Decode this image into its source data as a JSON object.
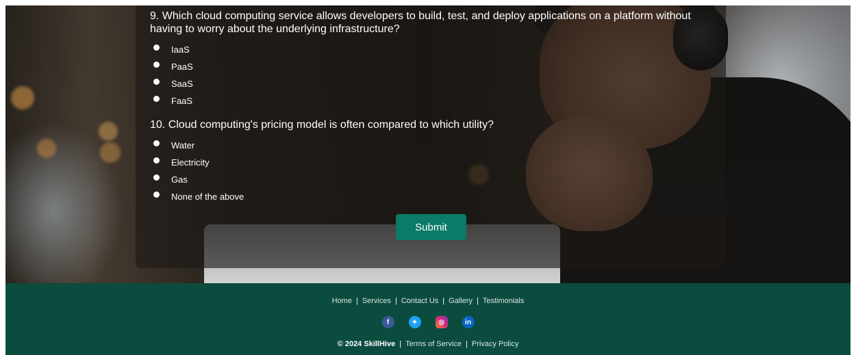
{
  "quiz": {
    "questions": [
      {
        "text": "9. Which cloud computing service allows developers to build, test, and deploy applications on a platform without having to worry about the underlying infrastructure?",
        "options": [
          "IaaS",
          "PaaS",
          "SaaS",
          "FaaS"
        ]
      },
      {
        "text": "10. Cloud computing's pricing model is often compared to which utility?",
        "options": [
          "Water",
          "Electricity",
          "Gas",
          "None of the above"
        ]
      }
    ],
    "submit_label": "Submit"
  },
  "footer": {
    "nav": [
      "Home",
      "Services",
      "Contact Us",
      "Gallery",
      "Testimonials"
    ],
    "separator": "|",
    "social": [
      {
        "icon": "facebook-icon",
        "glyph": "f",
        "color": "#3b5998"
      },
      {
        "icon": "twitter-icon",
        "glyph": "✦",
        "color": "#1da1f2"
      },
      {
        "icon": "instagram-icon",
        "glyph": "◎",
        "color": "#dd2a7b"
      },
      {
        "icon": "linkedin-icon",
        "glyph": "in",
        "color": "#0a66c2"
      }
    ],
    "copyright": "© 2024 SkillHive",
    "terms": "Terms of Service",
    "privacy": "Privacy Policy"
  },
  "colors": {
    "footer_bg": "#0b4c3f",
    "button_bg": "#0b7a66"
  }
}
